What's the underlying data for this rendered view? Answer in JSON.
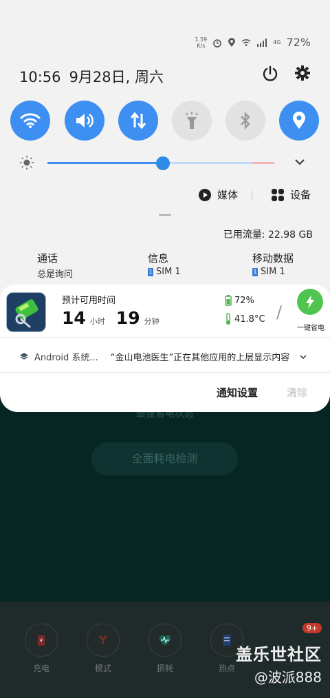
{
  "background_app": {
    "hint": "最佳省电状态",
    "check_button": "全面耗电检测",
    "nav": [
      {
        "label": "充电",
        "icon": "charge-icon"
      },
      {
        "label": "模式",
        "icon": "mode-icon"
      },
      {
        "label": "损耗",
        "icon": "heart-pulse-icon"
      },
      {
        "label": "热点",
        "icon": "document-icon"
      }
    ],
    "badge": "9+"
  },
  "watermark": {
    "line1": "盖乐世社区",
    "line2": "@波派888"
  },
  "status_bar": {
    "speed_top": "1.59",
    "speed_bottom": "K/s",
    "network": "4G",
    "battery": "72%"
  },
  "header": {
    "time": "10:56",
    "date": "9月28日, 周六"
  },
  "quick_settings": [
    {
      "name": "wifi",
      "state": "on",
      "icon": "wifi-icon"
    },
    {
      "name": "sound",
      "state": "on",
      "icon": "volume-icon"
    },
    {
      "name": "mobile-data",
      "state": "on",
      "icon": "data-transfer-icon"
    },
    {
      "name": "flashlight",
      "state": "off",
      "icon": "flashlight-icon"
    },
    {
      "name": "bluetooth",
      "state": "off",
      "icon": "bluetooth-icon"
    },
    {
      "name": "location",
      "state": "on",
      "icon": "location-icon"
    }
  ],
  "brightness": {
    "level": 0.51
  },
  "media_row": {
    "media_label": "媒体",
    "devices_label": "设备"
  },
  "data_usage": "已用流量: 22.98 GB",
  "sim_info": [
    {
      "title": "通话",
      "sub": "总是询问",
      "sim": false
    },
    {
      "title": "信息",
      "sub": "SIM 1",
      "sim": true
    },
    {
      "title": "移动数据",
      "sub": "SIM 1",
      "sim": true
    }
  ],
  "sim_badge": "1",
  "battery_card": {
    "label": "预计可用时间",
    "hours": "14",
    "hours_unit": "小时",
    "minutes": "19",
    "minutes_unit": "分钟",
    "battery_pct": "72%",
    "temperature": "41.8°C",
    "slash": "/",
    "save_label": "一键省电"
  },
  "system_notification": {
    "source": "Android 系统...",
    "message": "“金山电池医生”正在其他应用的上层显示内容"
  },
  "actions": {
    "settings": "通知设置",
    "clear": "清除"
  },
  "colors": {
    "accent": "#3d90f1",
    "save_green": "#4fc44f"
  }
}
